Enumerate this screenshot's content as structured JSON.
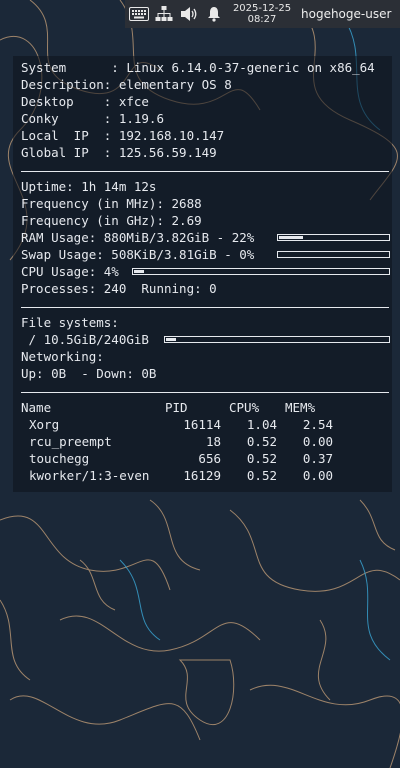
{
  "panel": {
    "icons": [
      "keyboard-icon",
      "network-icon",
      "volume-icon",
      "notification-bell-icon"
    ],
    "clock_date": "2025-12-25",
    "clock_time": "08:27",
    "username": "hogehoge-user"
  },
  "conky": {
    "system": {
      "system": "System      : Linux 6.14.0-37-generic on x86_64",
      "description": "Description: elementary OS 8",
      "desktop": "Desktop    : xfce",
      "conky": "Conky      : 1.19.6",
      "local_ip": "Local  IP  : 192.168.10.147",
      "global_ip": "Global IP  : 125.56.59.149"
    },
    "stats": {
      "uptime": "Uptime: 1h 14m 12s",
      "freq_mhz": "Frequency (in MHz): 2688",
      "freq_ghz": "Frequency (in GHz): 2.69",
      "ram": "RAM Usage: 880MiB/3.82GiB - 22%",
      "swap": "Swap Usage: 508KiB/3.81GiB - 0%",
      "cpu": "CPU Usage: 4%",
      "processes": "Processes: 240  Running: 0",
      "ram_fraction": 0.22,
      "swap_fraction": 0.0,
      "cpu_fraction": 0.04
    },
    "fs": {
      "heading": "File systems:",
      "root": " / 10.5GiB/240GiB",
      "root_fraction": 0.044
    },
    "net": {
      "heading": "Networking:",
      "updown": "Up: 0B  - Down: 0B"
    },
    "processes": {
      "headers": [
        "Name",
        "PID",
        "CPU%",
        "MEM%"
      ],
      "rows": [
        [
          "Xorg",
          "16114",
          "1.04",
          "2.54"
        ],
        [
          "rcu_preempt",
          "18",
          "0.52",
          "0.00"
        ],
        [
          "touchegg",
          "656",
          "0.52",
          "0.37"
        ],
        [
          "kworker/1:3-even",
          "16129",
          "0.52",
          "0.00"
        ]
      ]
    }
  }
}
